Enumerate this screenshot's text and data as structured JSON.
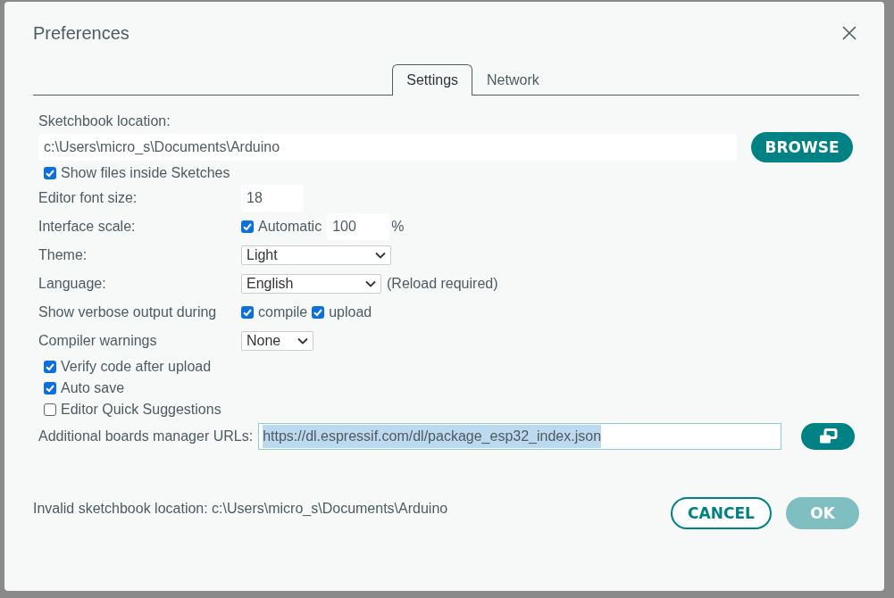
{
  "dialog": {
    "title": "Preferences"
  },
  "tabs": [
    {
      "label": "Settings",
      "selected": true
    },
    {
      "label": "Network",
      "selected": false
    }
  ],
  "sketchbook": {
    "label": "Sketchbook location:",
    "value": "c:\\Users\\micro_s\\Documents\\Arduino",
    "browse": "BROWSE"
  },
  "show_files": {
    "label": "Show files inside Sketches",
    "checked": true
  },
  "font_size": {
    "label": "Editor font size:",
    "value": "18"
  },
  "interface_scale": {
    "label": "Interface scale:",
    "automatic": {
      "label": "Automatic",
      "checked": true
    },
    "value": "100",
    "unit": "%"
  },
  "theme": {
    "label": "Theme:",
    "value": "Light"
  },
  "language": {
    "label": "Language:",
    "value": "English",
    "note": "(Reload required)"
  },
  "verbose": {
    "label": "Show verbose output during",
    "options": [
      {
        "label": "compile",
        "checked": true
      },
      {
        "label": "upload",
        "checked": true
      }
    ]
  },
  "compiler_warnings": {
    "label": "Compiler warnings",
    "value": "None"
  },
  "options": [
    {
      "label": "Verify code after upload",
      "checked": true
    },
    {
      "label": "Auto save",
      "checked": true
    },
    {
      "label": "Editor Quick Suggestions",
      "checked": false
    }
  ],
  "boards_urls": {
    "label": "Additional boards manager URLs:",
    "value": "https://dl.espressif.com/dl/package_esp32_index.json",
    "text_selected": true
  },
  "status": "Invalid sketchbook location: c:\\Users\\micro_s\\Documents\\Arduino",
  "buttons": [
    {
      "label": "CANCEL",
      "kind": "secondary",
      "disabled": false
    },
    {
      "label": "OK",
      "kind": "primary",
      "disabled": true
    }
  ]
}
